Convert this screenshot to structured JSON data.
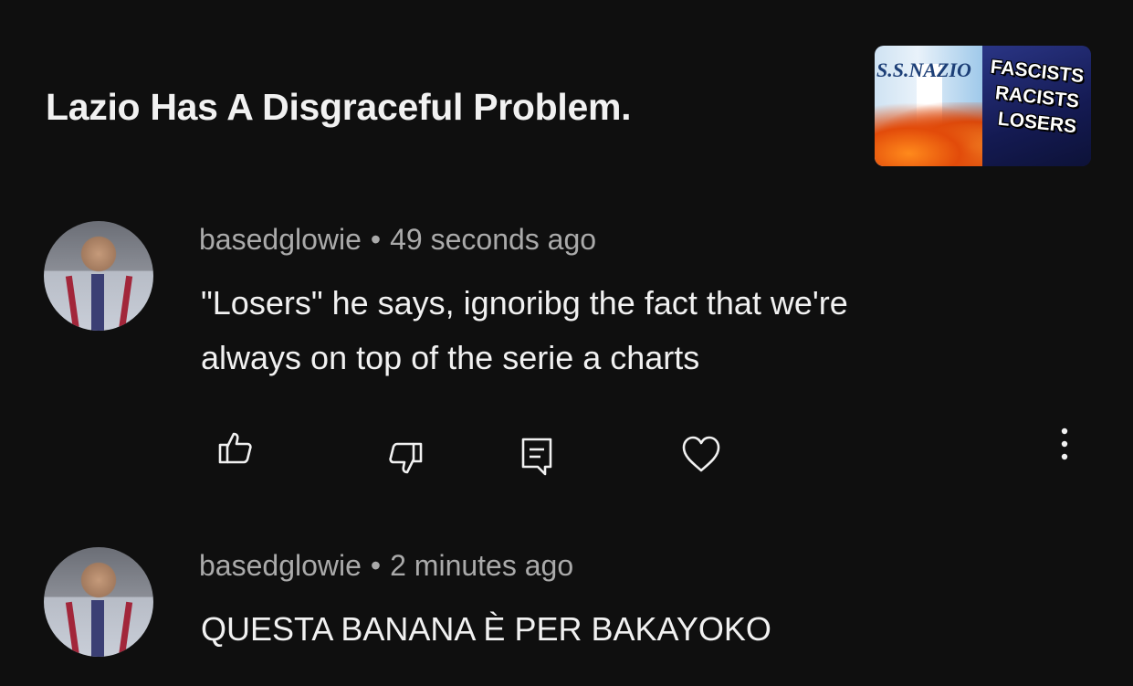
{
  "video": {
    "title": "Lazio Has A Disgraceful Problem.",
    "thumbnail": {
      "crest_text": "S.S.NAZIO",
      "lines": [
        "FASCISTS",
        "RACISTS",
        "LOSERS"
      ]
    }
  },
  "comments": [
    {
      "author": "basedglowie",
      "separator": "•",
      "time": "49 seconds ago",
      "line1": "\"Losers\" he says, ignoribg the fact that we're",
      "line2": "always on top of the serie a charts",
      "actions": [
        "like-icon",
        "dislike-icon",
        "reply-icon",
        "heart-icon",
        "more-icon"
      ]
    },
    {
      "author": "basedglowie",
      "separator": "•",
      "time": "2 minutes ago",
      "line1": "QUESTA BANANA È PER BAKAYOKO"
    }
  ],
  "colors": {
    "background": "#0f0f0f",
    "primary_text": "#f1f1f1",
    "secondary_text": "#aaaaaa"
  }
}
